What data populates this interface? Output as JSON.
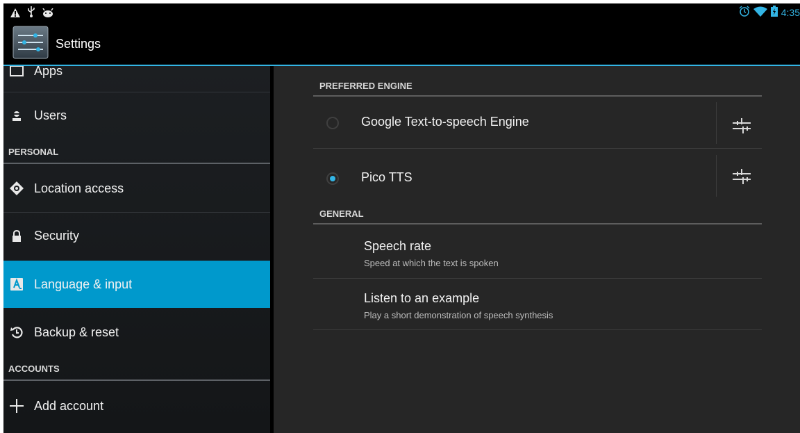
{
  "status_bar": {
    "icons": [
      "warning-icon",
      "usb-icon",
      "android-debug-icon",
      "alarm-icon",
      "wifi-icon",
      "battery-icon"
    ],
    "time": "4:35"
  },
  "action_bar": {
    "title": "Settings",
    "icon": "settings-sliders-icon"
  },
  "sidebar": {
    "items": [
      {
        "label": "Apps",
        "icon": "apps-icon"
      },
      {
        "label": "Users",
        "icon": "user-icon"
      },
      {
        "label": "Location access",
        "icon": "location-icon"
      },
      {
        "label": "Security",
        "icon": "lock-icon"
      },
      {
        "label": "Language & input",
        "icon": "language-a-icon",
        "selected": true
      },
      {
        "label": "Backup & reset",
        "icon": "backup-icon"
      },
      {
        "label": "Add account",
        "icon": "plus-icon"
      }
    ],
    "headers": {
      "personal": "PERSONAL",
      "accounts": "ACCOUNTS"
    }
  },
  "content": {
    "preferred_engine_header": "PREFERRED ENGINE",
    "engines": [
      {
        "label": "Google Text-to-speech Engine",
        "selected": false
      },
      {
        "label": "Pico TTS",
        "selected": true
      }
    ],
    "general_header": "GENERAL",
    "preferences": [
      {
        "title": "Speech rate",
        "summary": "Speed at which the text is spoken"
      },
      {
        "title": "Listen to an example",
        "summary": "Play a short demonstration of speech synthesis"
      }
    ]
  },
  "colors": {
    "accent": "#33b5e5",
    "selected_bg": "#0099cc",
    "sidebar_bg": "#1a1d20",
    "content_bg": "#262626"
  }
}
